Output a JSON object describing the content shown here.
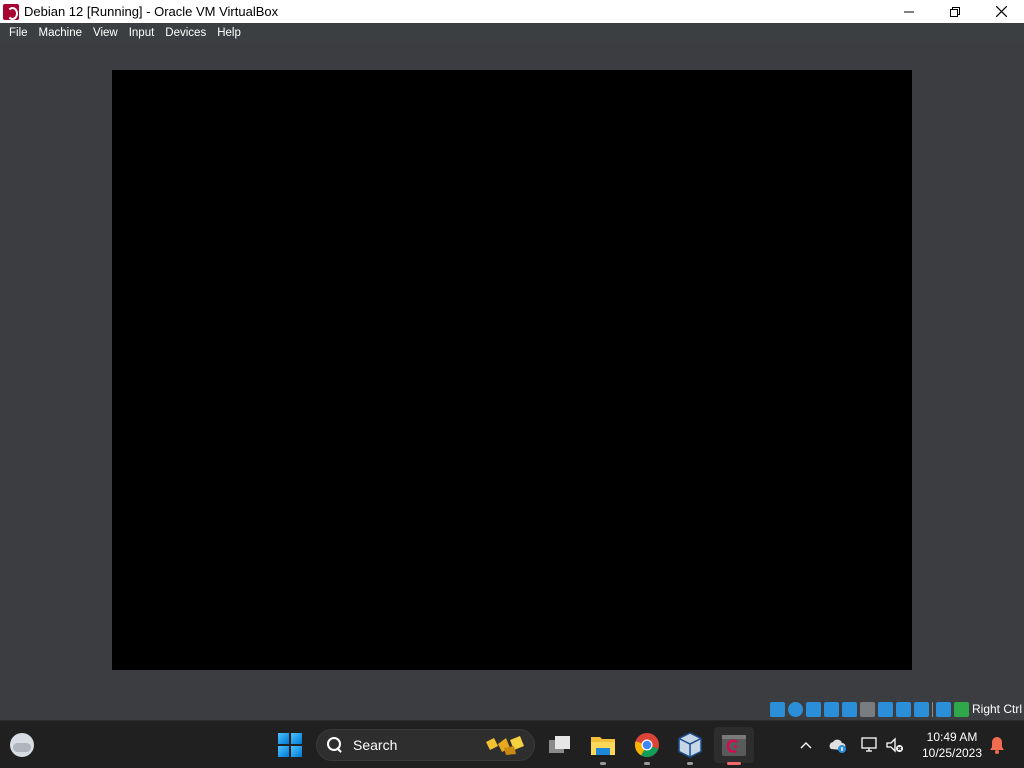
{
  "window": {
    "title": "Debian 12 [Running] - Oracle VM VirtualBox",
    "app_icon": "debian-icon"
  },
  "menu": {
    "items": [
      "File",
      "Machine",
      "View",
      "Input",
      "Devices",
      "Help"
    ]
  },
  "statusbar": {
    "icons": [
      "hard-disk-icon",
      "optical-drive-icon",
      "audio-icon",
      "network-icon",
      "usb-icon",
      "shared-folders-icon",
      "display-icon",
      "video-capture-icon",
      "virtualization-icon",
      "mouse-integration-icon",
      "keyboard-icon"
    ],
    "host_key": "Right Ctrl"
  },
  "taskbar": {
    "search_label": "Search",
    "apps": [
      "task-view",
      "file-explorer",
      "chrome",
      "virtualbox",
      "debian-vm"
    ],
    "active_app": "debian-vm",
    "time": "10:49 AM",
    "date": "10/25/2023"
  }
}
